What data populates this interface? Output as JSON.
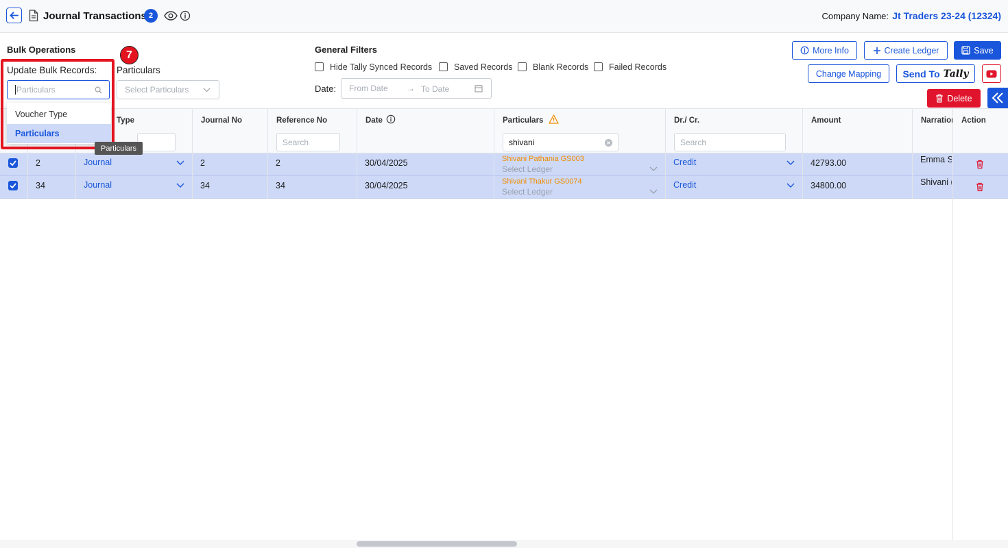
{
  "header": {
    "title": "Journal Transactions",
    "count": "2",
    "company_label": "Company Name:",
    "company_value": "Jt Traders 23-24 (12324)"
  },
  "bulk": {
    "title": "Bulk Operations",
    "update_label": "Update Bulk Records:",
    "field_placeholder": "Particulars",
    "particulars_label": "Particulars",
    "particulars_placeholder": "Select Particulars",
    "options": [
      "Voucher Type",
      "Particulars"
    ],
    "selected_option": "Particulars",
    "step_number": "7",
    "tooltip": "Particulars"
  },
  "filters": {
    "title": "General Filters",
    "checks": [
      "Hide Tally Synced Records",
      "Saved Records",
      "Blank Records",
      "Failed Records"
    ],
    "date_label": "Date:",
    "from_placeholder": "From Date",
    "to_placeholder": "To Date"
  },
  "actions": {
    "more_info": "More Info",
    "create_ledger": "Create Ledger",
    "save": "Save",
    "change_mapping": "Change Mapping",
    "send_to": "Send To",
    "tally_logo": "Tally",
    "delete": "Delete"
  },
  "table": {
    "columns": {
      "voucher_type": "Type",
      "journal_no": "Journal No",
      "reference_no": "Reference No",
      "date": "Date",
      "particulars": "Particulars",
      "dr_cr": "Dr./ Cr.",
      "amount": "Amount",
      "narration": "Narration",
      "action": "Action"
    },
    "search_placeholder": "Search",
    "particulars_search_value": "shivani",
    "rows": [
      {
        "sn": "2",
        "voucher_type": "Journal",
        "journal_no": "2",
        "reference_no": "2",
        "date": "30/04/2025",
        "particular_name": "Shivani Pathania GS003",
        "ledger_placeholder": "Select Ledger",
        "dr_cr": "Credit",
        "amount": "42793.00",
        "narration": "Emma S"
      },
      {
        "sn": "34",
        "voucher_type": "Journal",
        "journal_no": "34",
        "reference_no": "34",
        "date": "30/04/2025",
        "particular_name": "Shivani Thakur GS0074",
        "ledger_placeholder": "Select Ledger",
        "dr_cr": "Credit",
        "amount": "34800.00",
        "narration": "Shivani ("
      }
    ]
  },
  "colors": {
    "accent": "#1a56db",
    "danger": "#e0152d",
    "row_selected": "#cdd9f7",
    "warning": "#f08c00"
  }
}
